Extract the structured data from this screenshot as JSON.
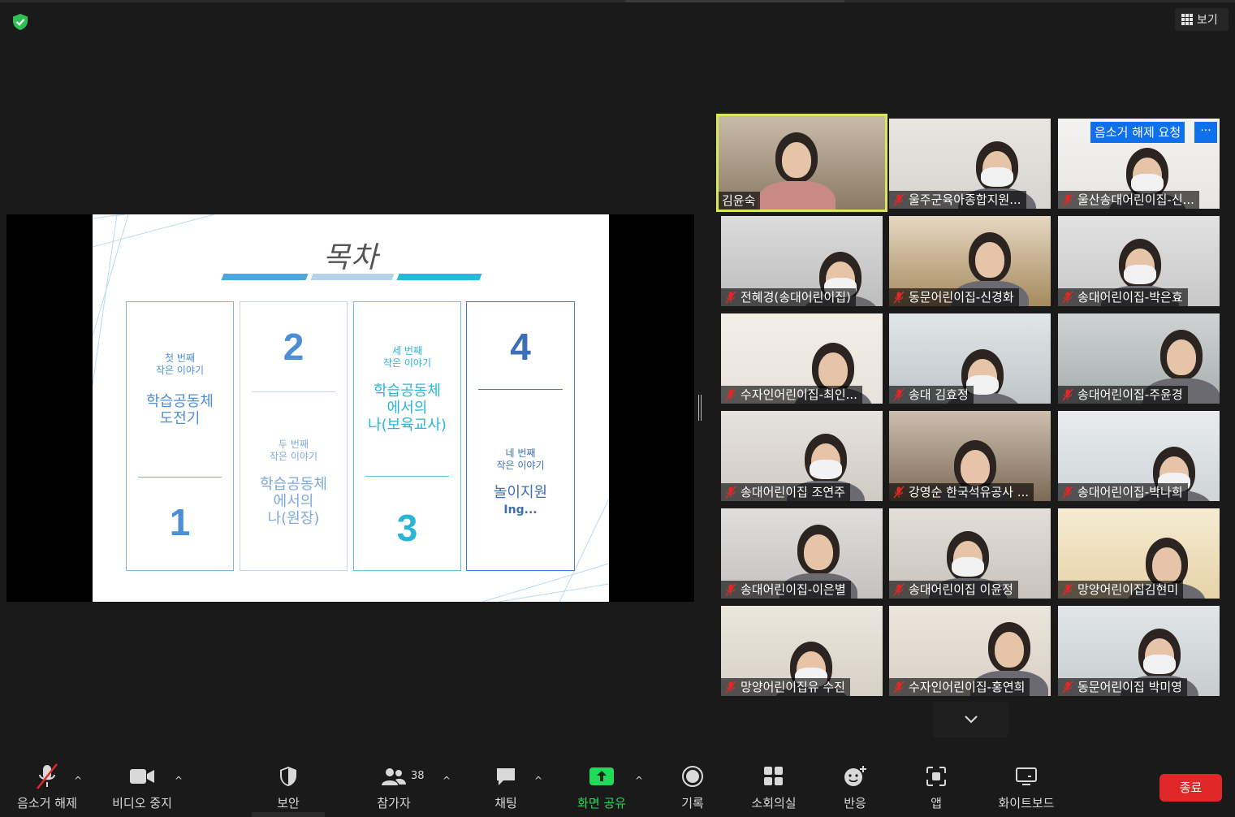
{
  "header": {
    "view_label": "보기",
    "security_icon": "shield-check-icon"
  },
  "slide": {
    "title": "목차",
    "bar_colors": [
      "#4da6e0",
      "#b5d3ea",
      "#2ab8d8"
    ],
    "cards": [
      {
        "small": [
          "첫 번째",
          "작은 이야기"
        ],
        "big": [
          "학습공동체",
          "도전기"
        ],
        "number": "1",
        "color": "#4d8fd6"
      },
      {
        "number": "2",
        "small": [
          "두 번째",
          "작은 이야기"
        ],
        "big": [
          "학습공동체",
          "에서의",
          "나(원장)"
        ],
        "color": "#4d8fd6"
      },
      {
        "small": [
          "세 번째",
          "작은 이야기"
        ],
        "big": [
          "학습공동체",
          "에서의",
          "나(보육교사)"
        ],
        "number": "3",
        "color": "#29b6d6"
      },
      {
        "number": "4",
        "small": [
          "네 번째",
          "작은 이야기"
        ],
        "big": [
          "놀이지원"
        ],
        "extra": "Ing...",
        "color": "#3b6fb6"
      }
    ]
  },
  "participants": [
    {
      "name": "김윤숙",
      "muted": false,
      "active": true
    },
    {
      "name": "울주군육아종합지원...",
      "muted": true
    },
    {
      "name": "울산송대어린이집-신...",
      "muted": true,
      "unmute_request": "음소거 해제 요청",
      "more": "···"
    },
    {
      "name": "전혜경(송대어린이집)",
      "muted": true
    },
    {
      "name": "동문어린이집-신경화",
      "muted": true
    },
    {
      "name": "송대어린이집-박은효",
      "muted": true
    },
    {
      "name": "수자인어린이집-최인...",
      "muted": true
    },
    {
      "name": "송대 김효정",
      "muted": true
    },
    {
      "name": "송대어린이집-주윤경",
      "muted": true
    },
    {
      "name": "송대어린이집 조연주",
      "muted": true
    },
    {
      "name": "강영순 한국석유공사 ...",
      "muted": true
    },
    {
      "name": "송대어린이집-박나희",
      "muted": true
    },
    {
      "name": "송대어린이집-이은별",
      "muted": true
    },
    {
      "name": "송대어린이집 이윤정",
      "muted": true
    },
    {
      "name": "망양어린이집김현미",
      "muted": true
    },
    {
      "name": "망양어린이집유 수진",
      "muted": true
    },
    {
      "name": "수자인어린이집-홍연희",
      "muted": true
    },
    {
      "name": "동문어린이집 박미영",
      "muted": true
    }
  ],
  "toolbar": {
    "unmute": "음소거 해제",
    "stop_video": "비디오 중지",
    "security": "보안",
    "participants": "참가자",
    "participants_count": "38",
    "chat": "채팅",
    "share_screen": "화면 공유",
    "record": "기록",
    "breakout": "소회의실",
    "reactions": "반응",
    "apps": "앱",
    "whiteboard": "화이트보드",
    "end": "종료"
  },
  "colors": {
    "share_green": "#23d959",
    "end_red": "#e02828",
    "active_outline": "#d8e85a",
    "muted_red": "#e02828"
  }
}
